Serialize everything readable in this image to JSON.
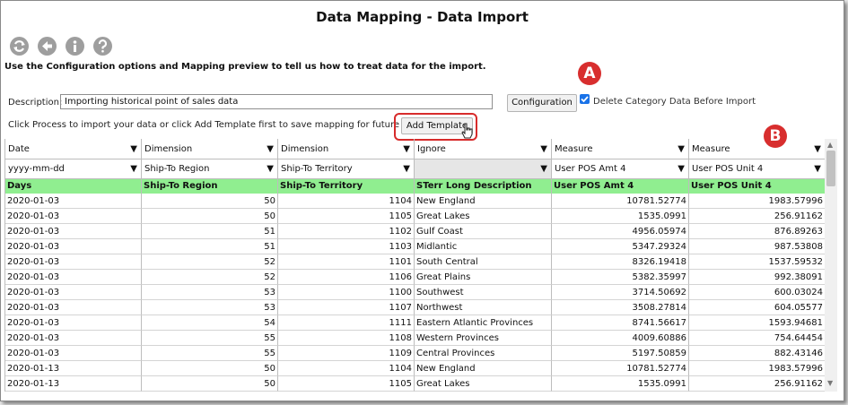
{
  "title": "Data Mapping - Data Import",
  "toolbar": [
    "refresh-icon",
    "back-icon",
    "info-icon",
    "help-icon"
  ],
  "instructions": "Use the Configuration options and Mapping preview to tell us how to treat data for the import.",
  "description": {
    "label": "Description:",
    "value": "Importing historical point of sales data"
  },
  "configuration_button": "Configuration",
  "delete_checkbox": {
    "label": "Delete Category Data Before Import",
    "checked": true
  },
  "process_text": "Click Process to import your data or click Add Template first to save mapping for future use.",
  "add_template_button": "Add Template",
  "markers": {
    "a": "A",
    "b": "B"
  },
  "highlight_color": "#d72b2b",
  "label_row_color": "#90ee90",
  "columns": [
    {
      "type": "Date",
      "format": "yyyy-mm-dd",
      "label": "Days"
    },
    {
      "type": "Dimension",
      "format": "Ship-To Region",
      "label": "Ship-To Region"
    },
    {
      "type": "Dimension",
      "format": "Ship-To Territory",
      "label": "Ship-To Territory"
    },
    {
      "type": "Ignore",
      "format": "",
      "label": "STerr Long Description"
    },
    {
      "type": "Measure",
      "format": "User POS Amt 4",
      "label": "User POS Amt 4"
    },
    {
      "type": "Measure",
      "format": "User POS Unit 4",
      "label": "User POS Unit 4"
    }
  ],
  "rows": [
    [
      "2020-01-03",
      "50",
      "1104",
      "New England",
      "10781.52774",
      "1983.57996"
    ],
    [
      "2020-01-03",
      "50",
      "1105",
      "Great Lakes",
      "1535.0991",
      "256.91162"
    ],
    [
      "2020-01-03",
      "51",
      "1102",
      "Gulf Coast",
      "4956.05974",
      "876.89263"
    ],
    [
      "2020-01-03",
      "51",
      "1103",
      "Midlantic",
      "5347.29324",
      "987.53808"
    ],
    [
      "2020-01-03",
      "52",
      "1101",
      "South Central",
      "8326.19418",
      "1537.59532"
    ],
    [
      "2020-01-03",
      "52",
      "1106",
      "Great Plains",
      "5382.35997",
      "992.38091"
    ],
    [
      "2020-01-03",
      "53",
      "1100",
      "Southwest",
      "3714.50692",
      "600.03024"
    ],
    [
      "2020-01-03",
      "53",
      "1107",
      "Northwest",
      "3508.27814",
      "604.05577"
    ],
    [
      "2020-01-03",
      "54",
      "1111",
      "Eastern Atlantic Provinces",
      "8741.56617",
      "1593.94681"
    ],
    [
      "2020-01-03",
      "55",
      "1108",
      "Western Provinces",
      "4009.60886",
      "754.64454"
    ],
    [
      "2020-01-03",
      "55",
      "1109",
      "Central Provinces",
      "5197.50859",
      "882.43146"
    ],
    [
      "2020-01-13",
      "50",
      "1104",
      "New England",
      "10781.52774",
      "1983.57996"
    ],
    [
      "2020-01-13",
      "50",
      "1105",
      "Great Lakes",
      "1535.0991",
      "256.91162"
    ]
  ]
}
